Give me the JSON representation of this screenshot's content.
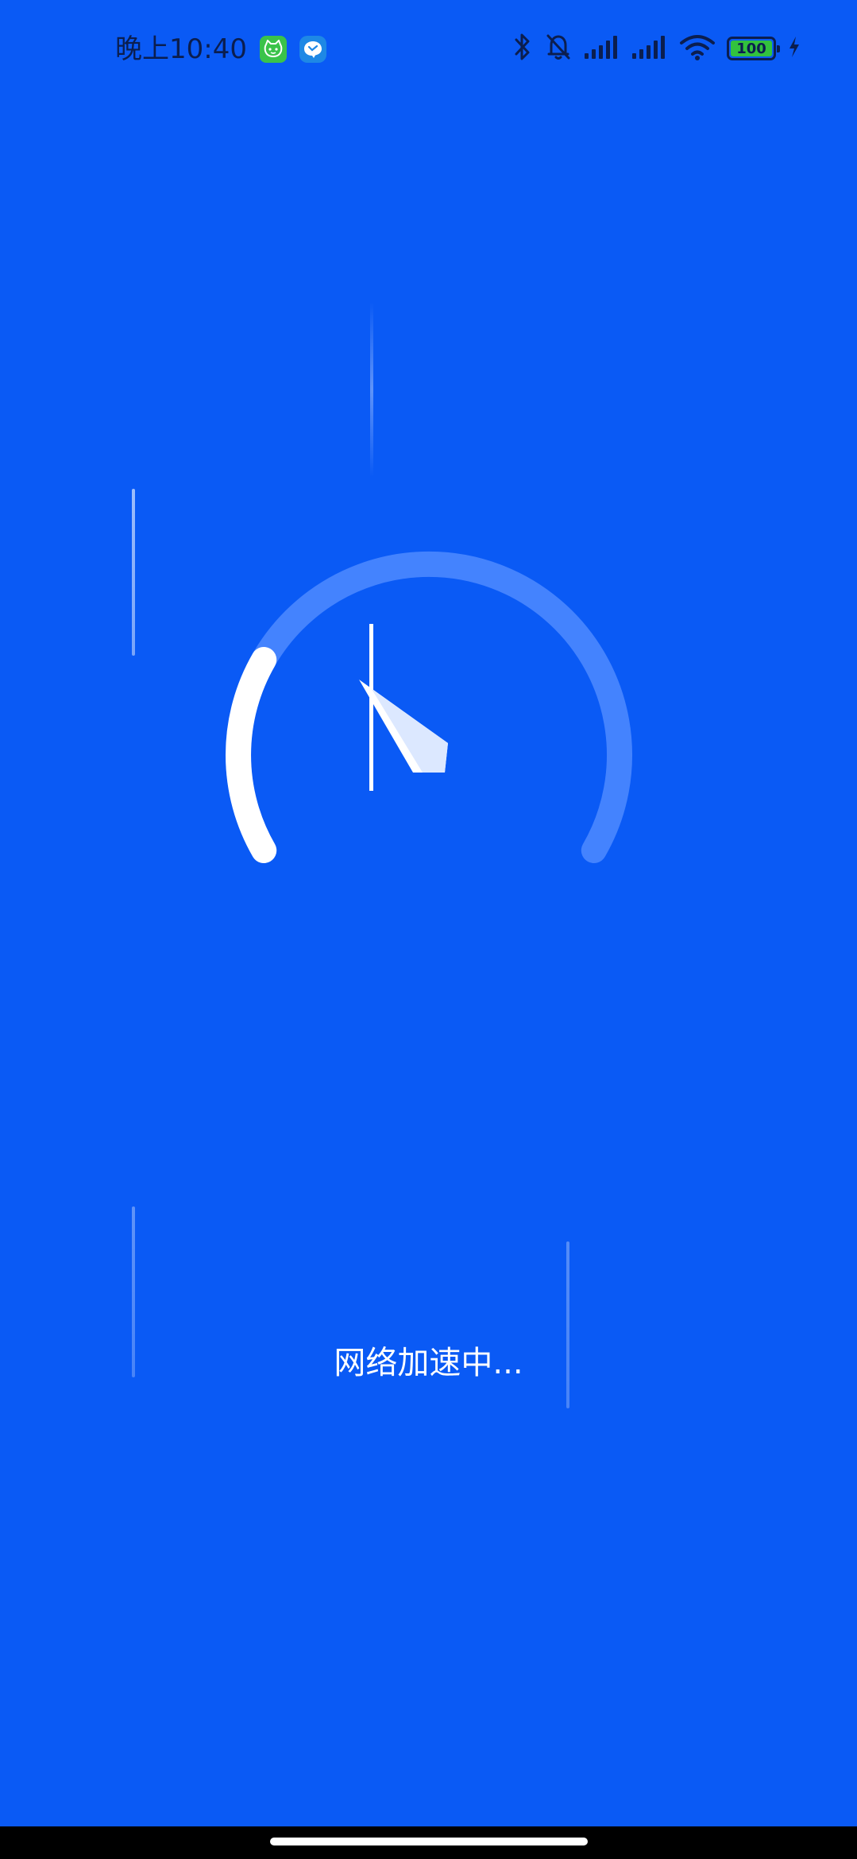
{
  "status_bar": {
    "time": "晚上10:40",
    "battery_level": "100",
    "icons": [
      "bluetooth-icon",
      "mute-bell-icon",
      "signal-icon",
      "signal-icon",
      "wifi-icon",
      "battery-icon",
      "charging-icon"
    ],
    "app_icons": [
      "green-cat-app-icon",
      "blue-chat-app-icon"
    ]
  },
  "speedometer": {
    "progress": 0.25
  },
  "caption": "网络加速中...",
  "colors": {
    "background": "#0A5AF5",
    "arc_active": "#FFFFFF",
    "arc_track": "#4F8BFF",
    "status_text": "#0B1E4F"
  }
}
